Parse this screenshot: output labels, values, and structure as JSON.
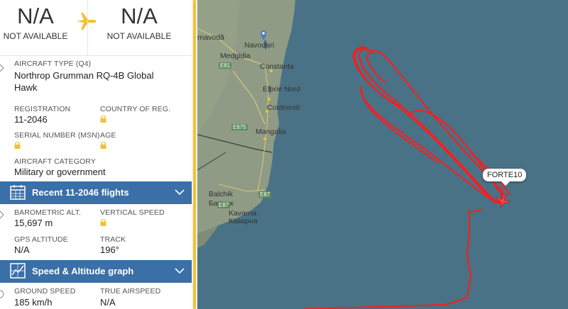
{
  "route": {
    "origin_code": "N/A",
    "origin_name": "NOT AVAILABLE",
    "destination_code": "N/A",
    "destination_name": "NOT AVAILABLE"
  },
  "aircraft": {
    "type_label": "AIRCRAFT TYPE (Q4)",
    "type_value": "Northrop Grumman RQ-4B Global Hawk",
    "registration_label": "REGISTRATION",
    "registration_value": "11-2046",
    "country_label": "COUNTRY OF REG.",
    "serial_label": "SERIAL NUMBER (MSN)",
    "age_label": "AGE",
    "category_label": "AIRCRAFT CATEGORY",
    "category_value": "Military or government"
  },
  "recent_flights": {
    "title": "Recent 11-2046 flights"
  },
  "flight": {
    "baro_label": "BAROMETRIC ALT.",
    "baro_value": "15,697 m",
    "vspeed_label": "VERTICAL SPEED",
    "gps_label": "GPS ALTITUDE",
    "gps_value": "N/A",
    "track_label": "TRACK",
    "track_value": "196°"
  },
  "graph": {
    "title": "Speed & Altitude graph"
  },
  "speed": {
    "ground_label": "GROUND SPEED",
    "ground_value": "185 km/h",
    "true_label": "TRUE AIRSPEED",
    "true_value": "N/A"
  },
  "map": {
    "callsign": "FORTE10",
    "places": [
      "Navodari",
      "Medgidia",
      "Constanta",
      "Eforie Nord",
      "Costinesti",
      "Mangalia",
      "Balchik",
      "Балчик",
      "Kavarna",
      "Каварна",
      "rnavodă"
    ],
    "roads": [
      "E81",
      "E87",
      "E675",
      "E87"
    ]
  },
  "colors": {
    "accent": "#f2c230",
    "section_bar": "#3a6fa7",
    "sea": "#4a7286",
    "track": "#ff1a1a"
  }
}
